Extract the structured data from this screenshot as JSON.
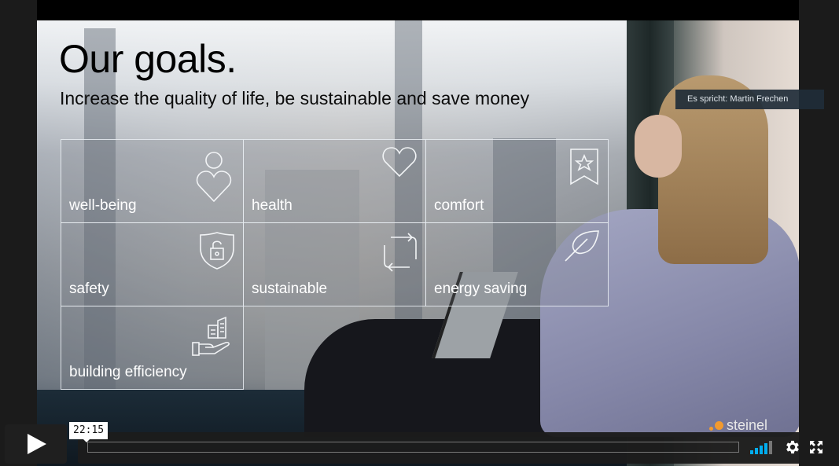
{
  "slide": {
    "title": "Our goals.",
    "subtitle": "Increase the quality of life, be sustainable and save money",
    "goals": [
      {
        "label": "well-being",
        "icon": "person-heart-icon"
      },
      {
        "label": "health",
        "icon": "heart-icon"
      },
      {
        "label": "comfort",
        "icon": "bookmark-star-icon"
      },
      {
        "label": "safety",
        "icon": "shield-lock-icon"
      },
      {
        "label": "sustainable",
        "icon": "cycle-arrows-icon"
      },
      {
        "label": "energy saving",
        "icon": "leaf-icon"
      },
      {
        "label": "building efficiency",
        "icon": "hand-building-icon"
      }
    ],
    "logo_text": "steinel",
    "brand_color": "#f29a2e"
  },
  "overlay": {
    "speaker_label": "Es spricht: Martin Frechen"
  },
  "player": {
    "time_tooltip": "22:15",
    "play_icon": "play-icon",
    "volume_icon": "volume-bars-icon",
    "volume_level_bars": 4,
    "volume_total_bars": 5,
    "settings_icon": "gear-icon",
    "fullscreen_icon": "fullscreen-icon",
    "accent_color": "#00adef"
  }
}
